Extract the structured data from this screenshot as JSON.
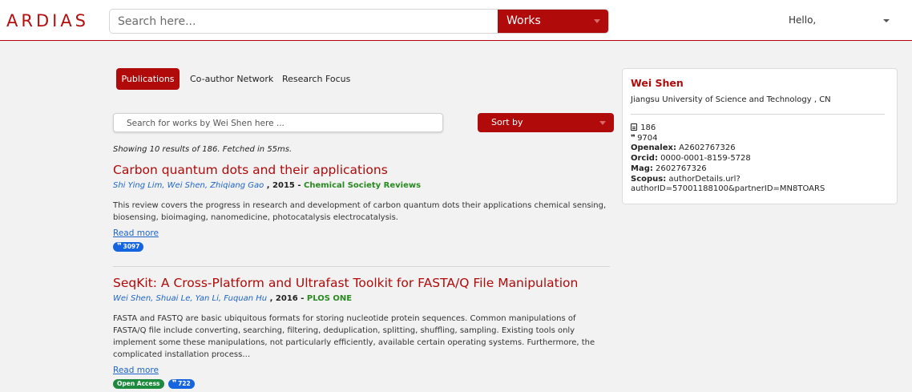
{
  "header": {
    "logo": "ARDIAS",
    "search_placeholder": "Search here...",
    "search_type": "Works",
    "greeting": "Hello,"
  },
  "tabs": [
    {
      "label": "Publications",
      "active": true
    },
    {
      "label": "Co-author Network",
      "active": false
    },
    {
      "label": "Research Focus",
      "active": false
    }
  ],
  "works_search": {
    "placeholder": "Search for works by Wei Shen here ...",
    "sort_label": "Sort by"
  },
  "results_info": "Showing 10 results of 186. Fetched in 55ms.",
  "results": [
    {
      "title": "Carbon quantum dots and their applications",
      "authors": "Shi Ying Lim, Wei Shen, Zhiqiang Gao",
      "year": "2015",
      "journal": "Chemical Society Reviews",
      "abstract": "This review covers the progress in research and development of carbon quantum dots their applications chemical sensing, biosensing, bioimaging, nanomedicine, photocatalysis electrocatalysis.",
      "read_more": "Read more",
      "open_access": "",
      "citations": "3097"
    },
    {
      "title": "SeqKit: A Cross-Platform and Ultrafast Toolkit for FASTA/Q File Manipulation",
      "authors": "Wei Shen, Shuai Le, Yan Li, Fuquan Hu",
      "year": "2016",
      "journal": "PLOS ONE",
      "abstract": "FASTA and FASTQ are basic ubiquitous formats for storing nucleotide protein sequences. Common manipulations of FASTA/Q file include converting, searching, filtering, deduplication, splitting, shuffling, sampling. Existing tools only implement some these manipulations, not particularly efficiently, available certain operating systems. Furthermore, the complicated installation process…",
      "read_more": "Read more",
      "open_access": "Open Access",
      "citations": "722"
    }
  ],
  "author": {
    "name": "Wei Shen",
    "affiliation": "Jiangsu University of Science and Technology , CN",
    "works_count": "186",
    "citations_count": "9704",
    "openalex_label": "Openalex:",
    "openalex": "A2602767326",
    "orcid_label": "Orcid:",
    "orcid": "0000-0001-8159-5728",
    "mag_label": "Mag:",
    "mag": "2602767326",
    "scopus_label": "Scopus:",
    "scopus": "authorDetails.url?authorID=57001188100&partnerID=MN8TOARS"
  },
  "colors": {
    "brand_red": "#b00a0a",
    "link_blue": "#1e64c8",
    "journal_green": "#2a8a22",
    "badge_blue": "#1565e0",
    "badge_green": "#1d8a3d"
  },
  "icons": [
    "caret-down-icon",
    "document-icon",
    "quote-icon"
  ]
}
